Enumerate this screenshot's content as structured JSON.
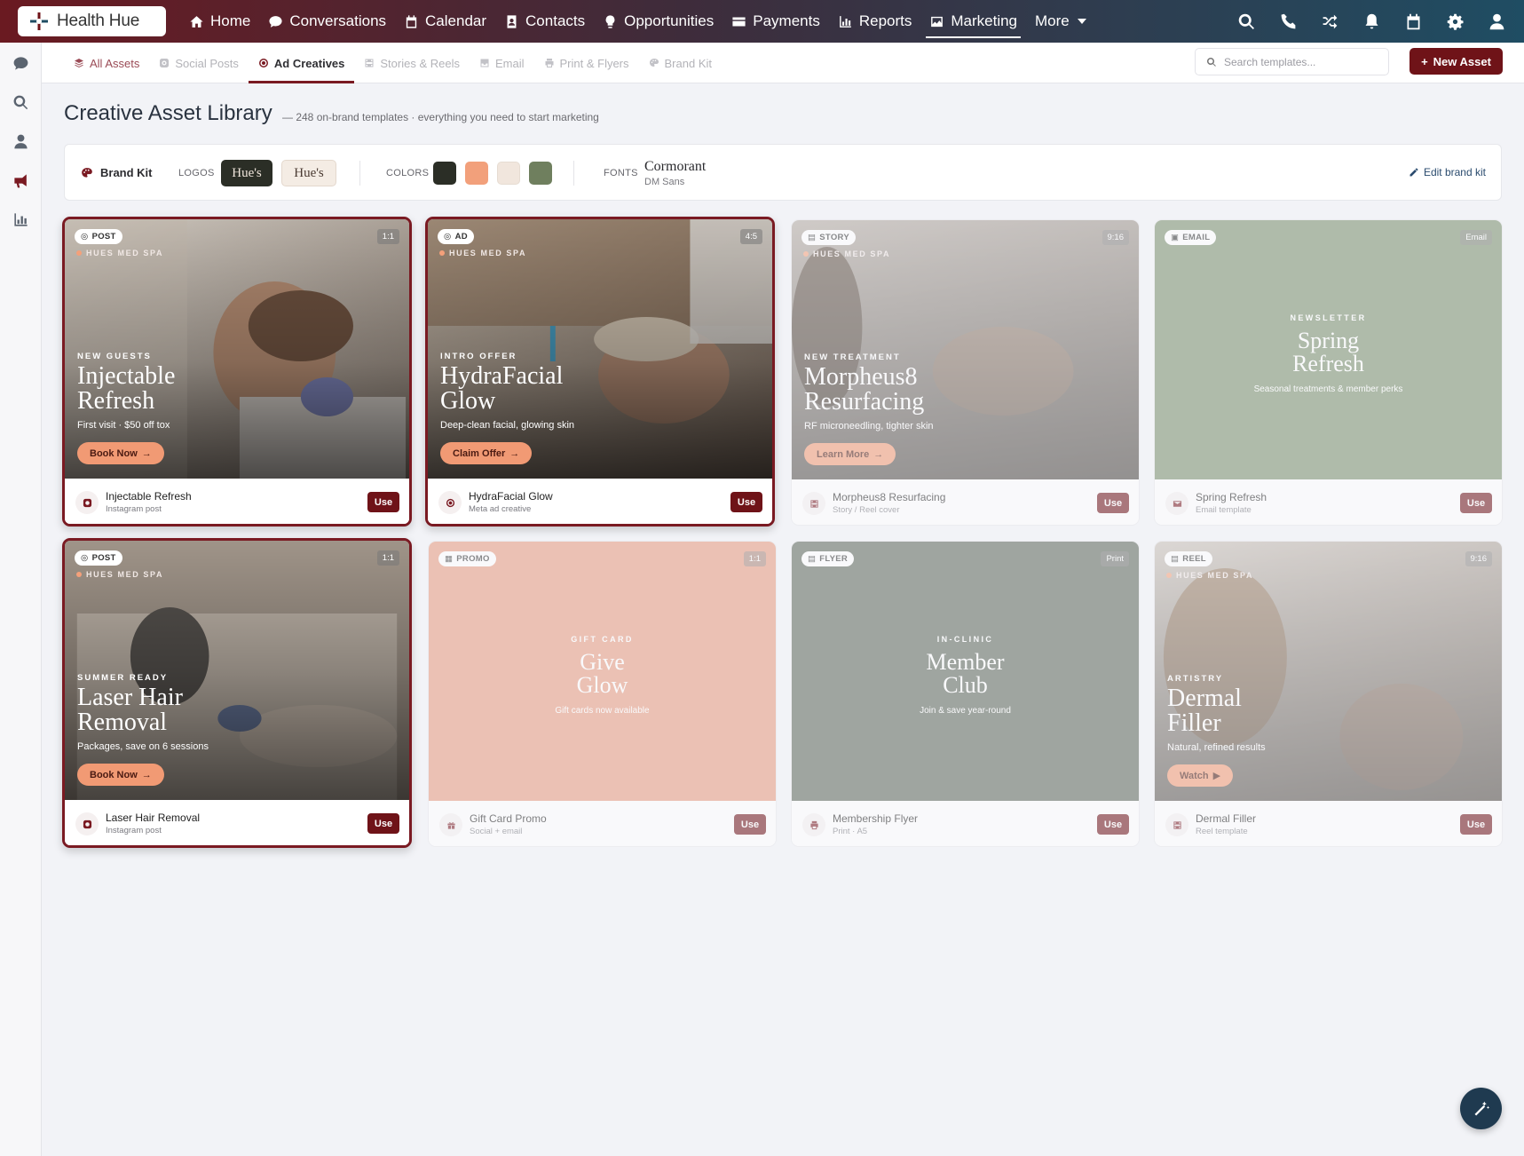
{
  "app": {
    "name": "Health Hue"
  },
  "nav": {
    "items": [
      {
        "label": "Home",
        "icon": "home-icon"
      },
      {
        "label": "Conversations",
        "icon": "chat-icon"
      },
      {
        "label": "Calendar",
        "icon": "calendar-icon"
      },
      {
        "label": "Contacts",
        "icon": "contacts-icon"
      },
      {
        "label": "Opportunities",
        "icon": "lightbulb-icon"
      },
      {
        "label": "Payments",
        "icon": "card-icon"
      },
      {
        "label": "Reports",
        "icon": "chart-icon"
      },
      {
        "label": "Marketing",
        "icon": "image-icon"
      },
      {
        "label": "More",
        "icon": "caret-down-icon"
      }
    ],
    "active": "Marketing",
    "right_icons": [
      "search-icon",
      "phone-icon",
      "shuffle-icon",
      "bell-icon",
      "calendar-icon",
      "gear-icon",
      "user-icon"
    ]
  },
  "rail": {
    "icons": [
      "chat-icon",
      "search-icon",
      "user-icon",
      "megaphone-icon",
      "bar-chart-icon"
    ],
    "active": "megaphone-icon"
  },
  "tabs": {
    "items": [
      "All Assets",
      "Social Posts",
      "Ad Creatives",
      "Stories & Reels",
      "Email",
      "Print & Flyers",
      "Brand Kit"
    ],
    "active": "Ad Creatives"
  },
  "search": {
    "placeholder": "Search templates..."
  },
  "new_asset": {
    "label": "New Asset"
  },
  "page": {
    "title": "Creative Asset Library",
    "subtitle": "— 248 on-brand templates · everything you need to start marketing"
  },
  "brand_kit": {
    "title": "Brand Kit",
    "logos_label": "LOGOS",
    "logo_dark": "Hue's",
    "logo_light": "Hue's",
    "colors_label": "COLORS",
    "colors": [
      "#2b2e26",
      "#f2a07b",
      "#f1e6dd",
      "#6f7f5e"
    ],
    "fonts_label": "FONTS",
    "font_primary": "Cormorant",
    "font_secondary": "DM Sans",
    "edit_label": "Edit brand kit"
  },
  "cards": [
    {
      "badge": "POST",
      "ratio": "1:1",
      "brand_tag": "HUES MED SPA",
      "eyebrow": "NEW GUESTS",
      "title_1": "Injectable",
      "title_2": "Refresh",
      "line": "First visit · $50 off tox",
      "cta": "Book Now",
      "name": "Injectable Refresh",
      "type": "Instagram post",
      "use": "Use"
    },
    {
      "badge": "AD",
      "ratio": "4:5",
      "brand_tag": "HUES MED SPA",
      "eyebrow": "INTRO OFFER",
      "title_1": "HydraFacial",
      "title_2": "Glow",
      "line": "Deep-clean facial, glowing skin",
      "cta": "Claim Offer",
      "name": "HydraFacial Glow",
      "type": "Meta ad creative",
      "use": "Use"
    },
    {
      "badge": "STORY",
      "ratio": "9:16",
      "brand_tag": "HUES MED SPA",
      "eyebrow": "NEW TREATMENT",
      "title_1": "Morpheus8",
      "title_2": "Resurfacing",
      "line": "RF microneedling, tighter skin",
      "cta": "Learn More",
      "name": "Morpheus8 Resurfacing",
      "type": "Story / Reel cover",
      "use": "Use"
    },
    {
      "badge": "EMAIL",
      "ratio": "Email",
      "eyebrow": "NEWSLETTER",
      "title_1": "Spring",
      "title_2": "Refresh",
      "line": "Seasonal treatments & member perks",
      "name": "Spring Refresh",
      "type": "Email template",
      "use": "Use"
    },
    {
      "badge": "POST",
      "ratio": "1:1",
      "brand_tag": "HUES MED SPA",
      "eyebrow": "SUMMER READY",
      "title_1": "Laser Hair",
      "title_2": "Removal",
      "line": "Packages, save on 6 sessions",
      "cta": "Book Now",
      "name": "Laser Hair Removal",
      "type": "Instagram post",
      "use": "Use"
    },
    {
      "badge": "PROMO",
      "ratio": "1:1",
      "eyebrow": "GIFT CARD",
      "title_1": "Give",
      "title_2": "Glow",
      "line": "Gift cards now available",
      "name": "Gift Card Promo",
      "type": "Social + email",
      "use": "Use"
    },
    {
      "badge": "FLYER",
      "ratio": "Print",
      "eyebrow": "IN-CLINIC",
      "title_1": "Member",
      "title_2": "Club",
      "line": "Join & save year-round",
      "name": "Membership Flyer",
      "type": "Print · A5",
      "use": "Use"
    },
    {
      "badge": "REEL",
      "ratio": "9:16",
      "brand_tag": "HUES MED SPA",
      "eyebrow": "ARTISTRY",
      "title_1": "Dermal",
      "title_2": "Filler",
      "line": "Natural, refined results",
      "cta": "Watch",
      "name": "Dermal Filler",
      "type": "Reel template",
      "use": "Use"
    }
  ]
}
